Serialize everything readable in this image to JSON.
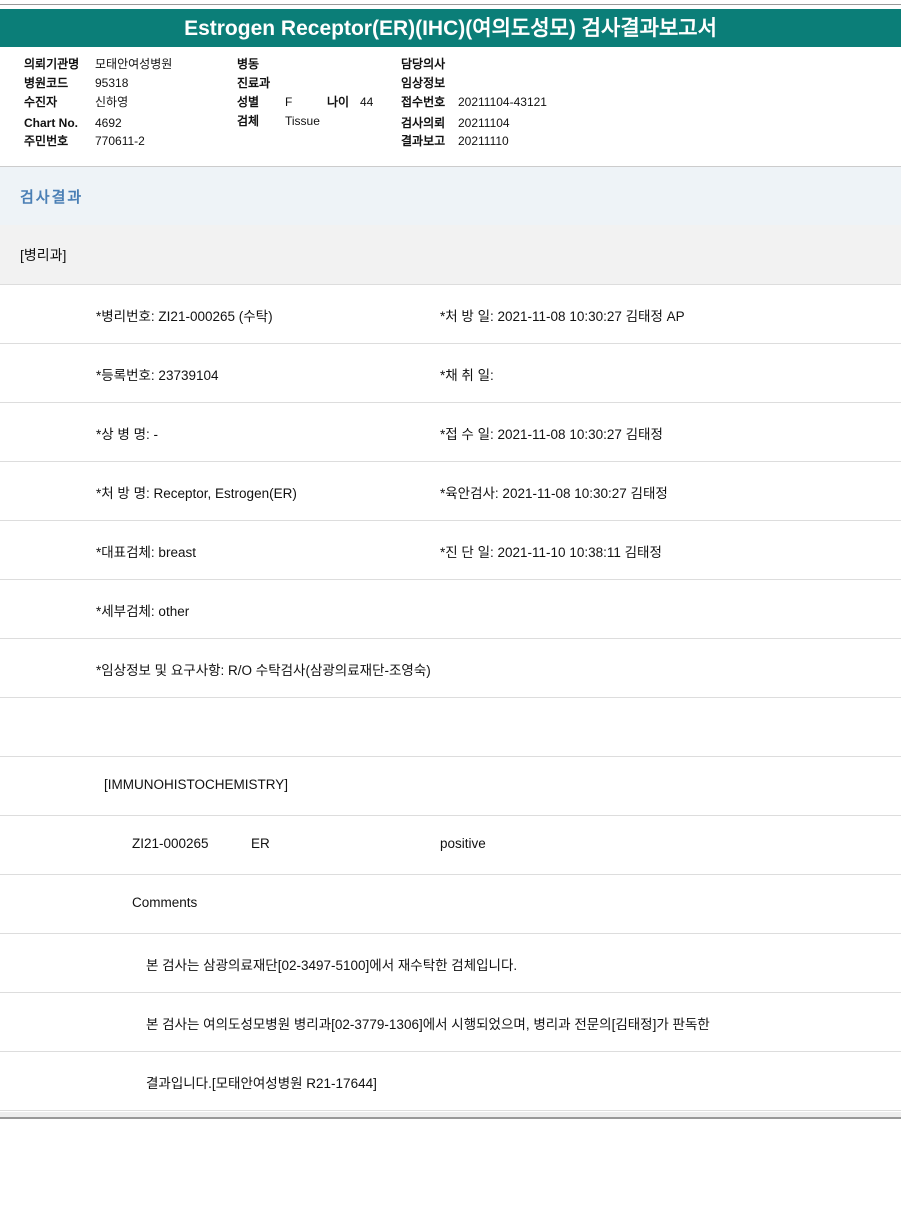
{
  "title": "Estrogen Receptor(ER)(IHC)(여의도성모) 검사결과보고서",
  "info": {
    "col1": [
      {
        "label": "의뢰기관명",
        "value": "모태안여성병원"
      },
      {
        "label": "병원코드",
        "value": "95318"
      },
      {
        "label": "수진자",
        "value": "신하영"
      },
      {
        "label": "Chart No.",
        "value": "4692"
      },
      {
        "label": "주민번호",
        "value": "770611-2"
      }
    ],
    "col2": [
      {
        "label": "병동",
        "value": ""
      },
      {
        "label": "진료과",
        "value": ""
      },
      {
        "label": "성별",
        "value": "F"
      },
      {
        "label": "검체",
        "value": "Tissue"
      }
    ],
    "age": {
      "label": "나이",
      "value": "44"
    },
    "col3": [
      {
        "label": "담당의사",
        "value": ""
      },
      {
        "label": "임상정보",
        "value": ""
      },
      {
        "label": "접수번호",
        "value": "20211104-43121"
      },
      {
        "label": "검사의뢰",
        "value": "20211104"
      },
      {
        "label": "결과보고",
        "value": "20211110"
      }
    ]
  },
  "section_title": "검사결과",
  "department": "[병리과]",
  "rows": [
    {
      "left": "*병리번호: ZI21-000265 (수탁)",
      "right": "*처 방 일: 2021-11-08 10:30:27  김태정 AP"
    },
    {
      "left": "*등록번호: 23739104",
      "right": "*채 취 일:"
    },
    {
      "left": "*상 병 명: -",
      "right": "*접 수 일: 2021-11-08 10:30:27  김태정"
    },
    {
      "left": "*처 방 명: Receptor, Estrogen(ER)",
      "right": "*육안검사: 2021-11-08 10:30:27  김태정"
    },
    {
      "left": "*대표검체: breast",
      "right": "*진 단 일: 2021-11-10 10:38:11  김태정"
    },
    {
      "left": "*세부검체: other",
      "right": ""
    },
    {
      "left": "*임상정보 및 요구사항: R/O 수탁검사(삼광의료재단-조영숙)",
      "right": ""
    }
  ],
  "ihc_header": "[IMMUNOHISTOCHEMISTRY]",
  "ihc_result": {
    "id": "ZI21-000265",
    "marker": "ER",
    "result": "positive"
  },
  "comments_label": "Comments",
  "comments": [
    "본 검사는 삼광의료재단[02-3497-5100]에서 재수탁한 검체입니다.",
    "본 검사는 여의도성모병원 병리과[02-3779-1306]에서 시행되었으며, 병리과 전문의[김태정]가 판독한",
    "결과입니다.[모태안여성병원 R21-17644]"
  ]
}
